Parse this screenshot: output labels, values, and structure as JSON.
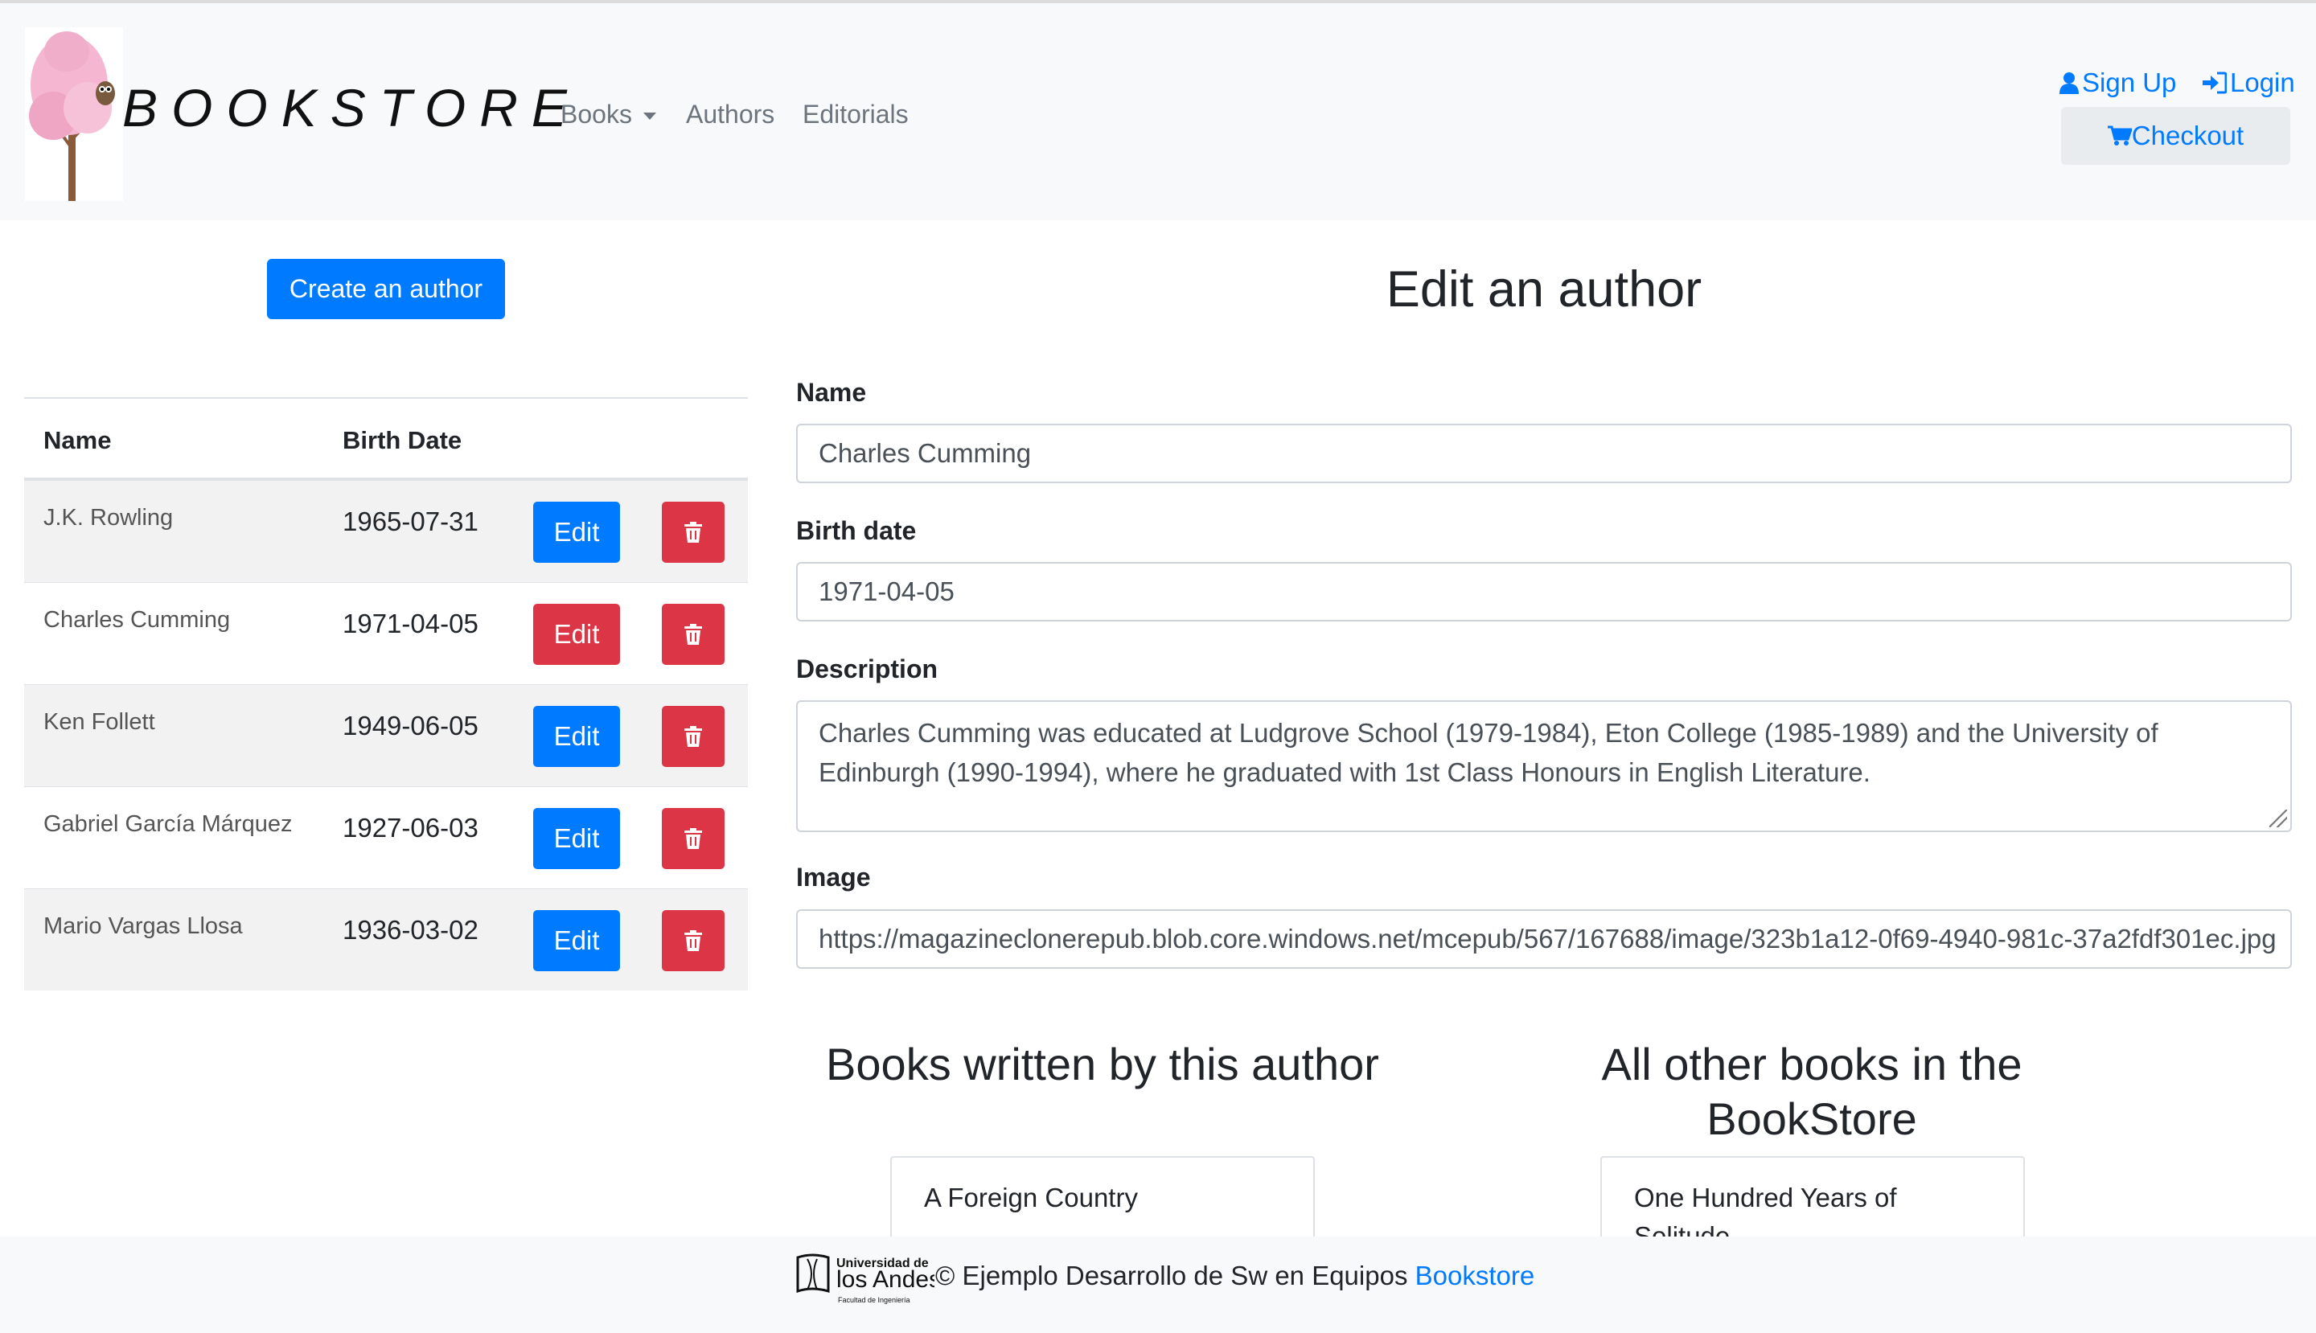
{
  "navbar": {
    "brand": "BOOKSTORE",
    "links": [
      "Books",
      "Authors",
      "Editorials"
    ],
    "sign_up": "Sign Up",
    "login": "Login",
    "checkout": "Checkout"
  },
  "left": {
    "create_button": "Create an author",
    "columns": [
      "Name",
      "Birth Date"
    ],
    "edit_label": "Edit",
    "authors": [
      {
        "name": "J.K. Rowling",
        "birth_date": "1965-07-31"
      },
      {
        "name": "Charles Cumming",
        "birth_date": "1971-04-05"
      },
      {
        "name": "Ken Follett",
        "birth_date": "1949-06-05"
      },
      {
        "name": "Gabriel García Márquez",
        "birth_date": "1927-06-03"
      },
      {
        "name": "Mario Vargas Llosa",
        "birth_date": "1936-03-02"
      }
    ]
  },
  "form": {
    "title": "Edit an author",
    "name_label": "Name",
    "name_value": "Charles Cumming",
    "birth_label": "Birth date",
    "birth_value": "1971-04-05",
    "description_label": "Description",
    "description_value": "Charles Cumming was educated at Ludgrove School (1979-1984), Eton College (1985-1989) and the University of Edinburgh (1990-1994), where he graduated with 1st Class Honours in English Literature.",
    "image_label": "Image",
    "image_value": "https://magazineclonerepub.blob.core.windows.net/mcepub/567/167688/image/323b1a12-0f69-4940-981c-37a2fdf301ec.jpg"
  },
  "books": {
    "by_author_title": "Books written by this author",
    "by_author_items": [
      "A Foreign Country"
    ],
    "other_title": "All other books in the BookStore",
    "other_items": [
      "One Hundred Years of Solitude"
    ]
  },
  "footer": {
    "logo_line1": "Universidad de",
    "logo_line2": "los Andes",
    "logo_line3": "Facultad de Ingeniería",
    "text": "© Ejemplo Desarrollo de Sw en Equipos",
    "link": "Bookstore"
  },
  "colors": {
    "primary": "#007bff",
    "danger": "#dc3545",
    "navbar_bg": "#f8f9fa"
  }
}
